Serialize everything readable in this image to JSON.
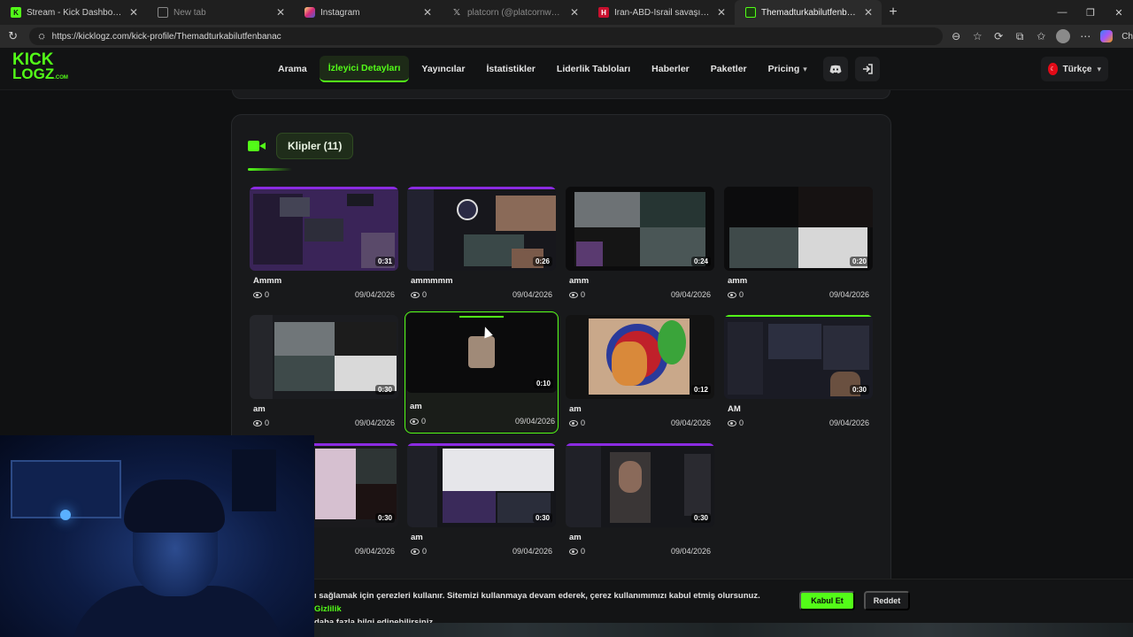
{
  "browser": {
    "tabs": [
      {
        "title": "Stream - Kick Dashboard",
        "icon": "kick-icon",
        "active": false
      },
      {
        "title": "New tab",
        "icon": "newtab-icon",
        "active": false
      },
      {
        "title": "Instagram",
        "icon": "instagram-icon",
        "active": false
      },
      {
        "title": "platcorn (@platcornweb) / X",
        "icon": "x-icon",
        "active": false
      },
      {
        "title": "İran-ABD-İsrail savaşı son dakika...",
        "icon": "news-icon",
        "active": false
      },
      {
        "title": "Themadturkabilutfenbanac - Kick L",
        "icon": "kicklogz-icon",
        "active": true
      }
    ],
    "url": "https://kicklogz.com/kick-profile/Themadturkabilutfenbanac",
    "tools_end": "Ch"
  },
  "header": {
    "logo_line1": "KICK",
    "logo_line2": "LOGZ",
    "logo_suffix": ".COM",
    "nav": [
      {
        "label": "Arama",
        "active": false
      },
      {
        "label": "İzleyici Detayları",
        "active": true
      },
      {
        "label": "Yayıncılar",
        "active": false
      },
      {
        "label": "İstatistikler",
        "active": false
      },
      {
        "label": "Liderlik Tabloları",
        "active": false
      },
      {
        "label": "Haberler",
        "active": false
      },
      {
        "label": "Paketler",
        "active": false
      },
      {
        "label": "Pricing",
        "active": false
      }
    ],
    "language": "Türkçe"
  },
  "clips": {
    "heading": "Klipler (11)",
    "items": [
      {
        "title": "Ammm",
        "views": "0",
        "date": "09/04/2026",
        "duration": "0:31"
      },
      {
        "title": "ammmmm",
        "views": "0",
        "date": "09/04/2026",
        "duration": "0:26"
      },
      {
        "title": "amm",
        "views": "0",
        "date": "09/04/2026",
        "duration": "0:24"
      },
      {
        "title": "amm",
        "views": "0",
        "date": "09/04/2026",
        "duration": "0:20"
      },
      {
        "title": "am",
        "views": "0",
        "date": "09/04/2026",
        "duration": "0:30"
      },
      {
        "title": "am",
        "views": "0",
        "date": "09/04/2026",
        "duration": "0:10"
      },
      {
        "title": "am",
        "views": "0",
        "date": "09/04/2026",
        "duration": "0:12"
      },
      {
        "title": "AM",
        "views": "0",
        "date": "09/04/2026",
        "duration": "0:30"
      },
      {
        "title": "",
        "views": "",
        "date": "09/04/2026",
        "duration": "0:30"
      },
      {
        "title": "am",
        "views": "0",
        "date": "09/04/2026",
        "duration": "0:30"
      },
      {
        "title": "am",
        "views": "0",
        "date": "09/04/2026",
        "duration": "0:30"
      }
    ]
  },
  "cookie": {
    "line1": "ı sağlamak için çerezleri kullanır. Sitemizi kullanmaya devam ederek, çerez kullanımımızı kabul etmiş olursunuz.",
    "link": "Gizlilik",
    "line2": "daha fazla bilgi edinebilirsiniz.",
    "accept": "Kabul Et",
    "reject": "Reddet"
  },
  "colors": {
    "accent": "#53fc18",
    "background": "#101112",
    "panel": "#18191b"
  }
}
